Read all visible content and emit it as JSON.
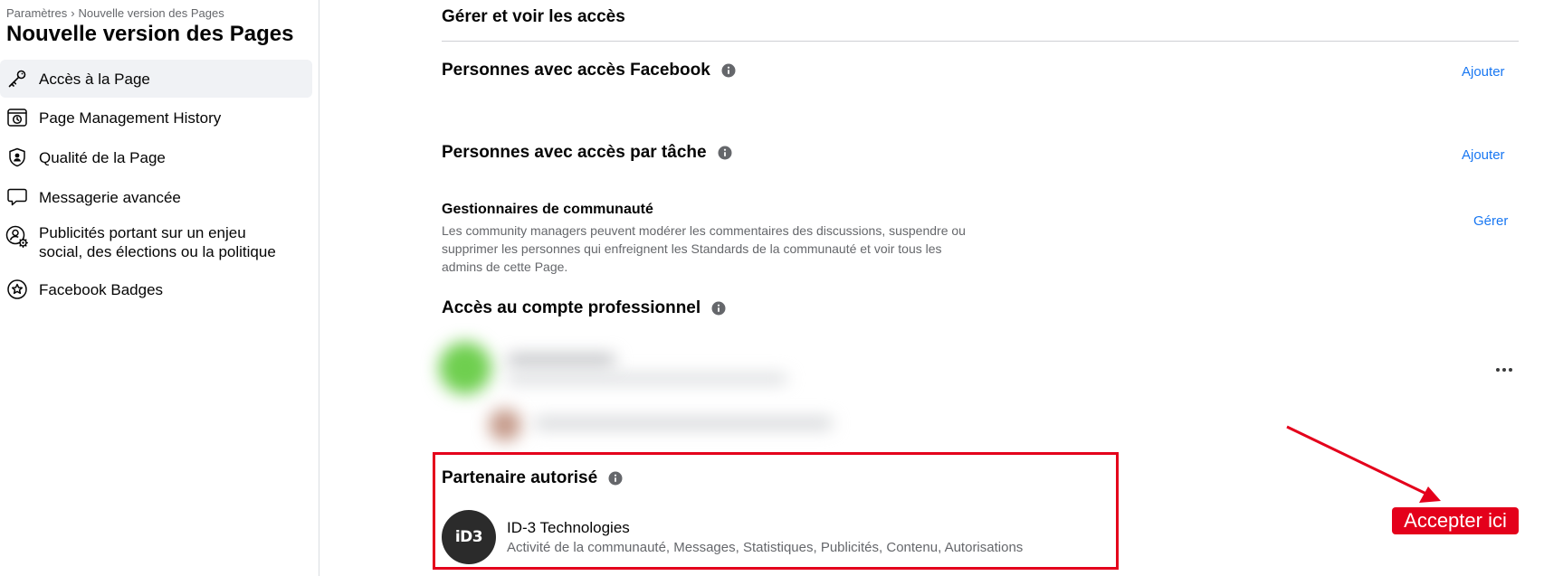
{
  "sidebar": {
    "breadcrumb": {
      "root": "Paramètres",
      "separator": "›",
      "current": "Nouvelle version des Pages"
    },
    "title": "Nouvelle version des Pages",
    "items": [
      {
        "label": "Accès à la Page",
        "icon": "key-icon",
        "active": true
      },
      {
        "label": "Page Management History",
        "icon": "history-icon",
        "active": false
      },
      {
        "label": "Qualité de la Page",
        "icon": "shield-user-icon",
        "active": false
      },
      {
        "label": "Messagerie avancée",
        "icon": "chat-bubble-icon",
        "active": false
      },
      {
        "label": "Publicités portant sur un enjeu social, des élections ou la politique",
        "icon": "person-gear-icon",
        "active": false
      },
      {
        "label": "Facebook Badges",
        "icon": "star-badge-icon",
        "active": false
      }
    ]
  },
  "main": {
    "section_title": "Gérer et voir les accès",
    "facebook_access": {
      "title": "Personnes avec accès Facebook",
      "action": "Ajouter"
    },
    "task_access": {
      "title": "Personnes avec accès par tâche",
      "action": "Ajouter"
    },
    "community_managers": {
      "title": "Gestionnaires de communauté",
      "description": "Les community managers peuvent modérer les commentaires des discussions, suspendre ou supprimer les personnes qui enfreignent les Standards de la communauté et voir tous les admins de cette Page.",
      "action": "Gérer"
    },
    "business_access": {
      "title": "Accès au compte professionnel"
    },
    "authorized_partner": {
      "title": "Partenaire autorisé",
      "partner_name": "ID-3 Technologies",
      "logo_text": "iD3",
      "permissions": "Activité de la communauté, Messages, Statistiques, Publicités, Contenu, Autorisations"
    }
  },
  "annotation": {
    "label": "Accepter ici"
  },
  "colors": {
    "accent": "#1877f2",
    "annotation_red": "#e4001b",
    "secondary_text": "#65676b"
  }
}
